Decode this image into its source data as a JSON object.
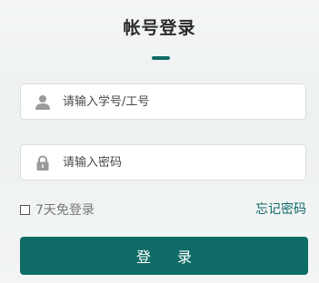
{
  "form": {
    "title": "帐号登录",
    "accent_color": "#0f6b66",
    "username": {
      "placeholder": "请输入学号/工号",
      "value": "",
      "icon": "user-icon"
    },
    "password": {
      "placeholder": "请输入密码",
      "value": "",
      "icon": "lock-icon"
    },
    "remember_label": "7天免登录",
    "remember_checked": false,
    "forgot_label": "忘记密码",
    "submit_label": "登 录"
  }
}
